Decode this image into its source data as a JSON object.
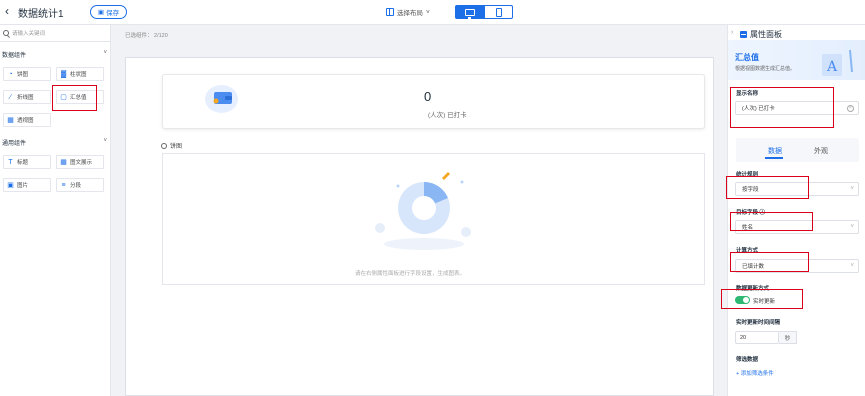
{
  "topbar": {
    "back_icon": "chevron-left-icon",
    "title": "数据统计1",
    "save_label": "保存",
    "layout_label": "选择布局",
    "device_active": "pc"
  },
  "left_panel": {
    "search_placeholder": "请输入关键词",
    "groups": [
      {
        "title": "数据组件",
        "items": [
          {
            "label": "饼图",
            "icon": "pie-icon"
          },
          {
            "label": "柱状图",
            "icon": "bar-chart-icon"
          },
          {
            "label": "折线图",
            "icon": "line-chart-icon"
          },
          {
            "label": "汇总值",
            "icon": "monitor-icon"
          },
          {
            "label": "透视图",
            "icon": "pivot-icon"
          }
        ]
      },
      {
        "title": "通用组件",
        "items": [
          {
            "label": "标题",
            "icon": "title-icon"
          },
          {
            "label": "图文展示",
            "icon": "image-text-icon"
          },
          {
            "label": "图片",
            "icon": "image-icon"
          },
          {
            "label": "分段",
            "icon": "list-icon"
          }
        ]
      }
    ]
  },
  "canvas": {
    "selected_count": "已选组件： 2/120",
    "stat_card": {
      "value": "0",
      "label": "(人次) 已打卡"
    },
    "pie_component_label": "饼图",
    "empty_hint": "请在右侧属性面板进行字段设置，生成图表。"
  },
  "right_panel": {
    "header": "属性面板",
    "hero_title": "汇总值",
    "hero_desc": "根据视图数据生成汇总值。",
    "display_name_label": "显示名称",
    "display_name_value": "(人次) 已打卡",
    "tabs": [
      "数据",
      "外观"
    ],
    "stat_rule_label": "统计规则",
    "stat_rule_value": "按字段",
    "target_field_label": "目标字段",
    "target_field_value": "姓名",
    "calc_label": "计算方式",
    "calc_value": "已填计数",
    "update_mode_label": "数据更新方式",
    "update_mode_value": "实时更新",
    "interval_label": "实时更新时间间隔",
    "interval_value": "20",
    "interval_unit": "秒",
    "filter_label": "筛选数据",
    "add_filter": "+ 添加筛选条件"
  },
  "colors": {
    "accent": "#1d6fe8",
    "highlight": "#d9001b",
    "toggle_on": "#2eb872"
  }
}
